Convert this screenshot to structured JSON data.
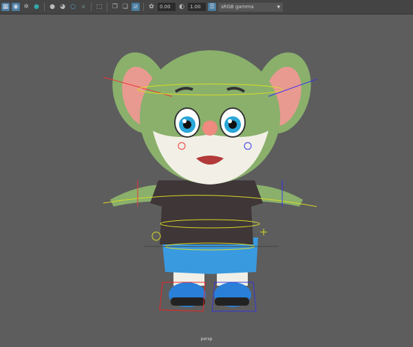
{
  "toolbar": {
    "exposure_value": "0.00",
    "gamma_value": "1.00",
    "color_space": "sRGB gamma",
    "icons": [
      "grid-icon",
      "xray-icon",
      "light-icon",
      "shadow-icon",
      "ambient-occlusion-icon",
      "motion-blur-icon",
      "antialias-icon",
      "depth-of-field-icon",
      "isolate-select-icon",
      "resolution-gate-icon",
      "gate-mask-icon",
      "safe-action-icon",
      "exposure-icon",
      "gamma-icon",
      "color-management-icon"
    ]
  },
  "viewport": {
    "camera_label": "persp"
  },
  "colors": {
    "background": "#5d5d5d",
    "toolbar": "#444444",
    "accent": "#4a7ea0"
  }
}
